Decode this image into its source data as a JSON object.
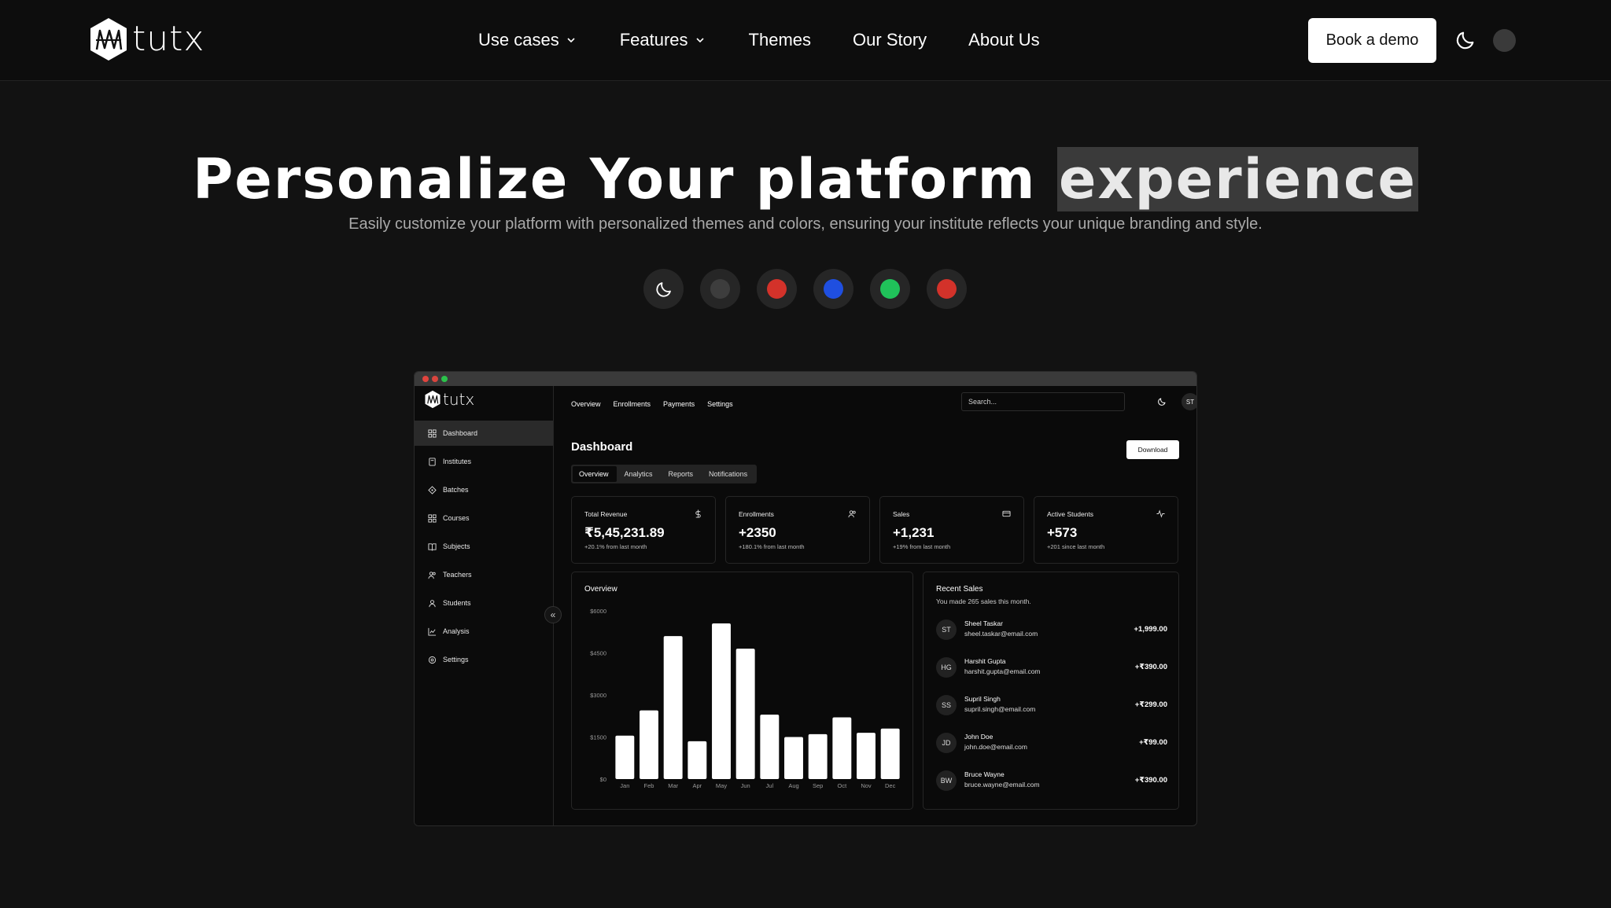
{
  "nav": {
    "brand": "tutx",
    "links": [
      {
        "label": "Use cases",
        "dropdown": true
      },
      {
        "label": "Features",
        "dropdown": true
      },
      {
        "label": "Themes",
        "dropdown": false
      },
      {
        "label": "Our Story",
        "dropdown": false
      },
      {
        "label": "About Us",
        "dropdown": false
      }
    ],
    "demo_label": "Book a demo"
  },
  "hero": {
    "title_main": "Personalize Your platform ",
    "title_highlight": "experience",
    "subtitle": "Easily customize your platform with personalized themes and colors, ensuring your institute reflects your unique branding and style."
  },
  "themes": [
    {
      "name": "dark-mode",
      "icon": "moon-icon"
    },
    {
      "name": "gray",
      "color": "#3d3d3d"
    },
    {
      "name": "red",
      "color": "#d3322a"
    },
    {
      "name": "blue",
      "color": "#1f4fe0"
    },
    {
      "name": "green",
      "color": "#20c25a"
    },
    {
      "name": "red-alt",
      "color": "#d3322a"
    }
  ],
  "app": {
    "brand": "tutx",
    "sidebar": [
      {
        "label": "Dashboard",
        "icon": "dashboard-icon",
        "active": true
      },
      {
        "label": "Institutes",
        "icon": "institute-icon"
      },
      {
        "label": "Batches",
        "icon": "batches-icon"
      },
      {
        "label": "Courses",
        "icon": "courses-icon"
      },
      {
        "label": "Subjects",
        "icon": "book-icon"
      },
      {
        "label": "Teachers",
        "icon": "users-icon"
      },
      {
        "label": "Students",
        "icon": "user-icon"
      },
      {
        "label": "Analysis",
        "icon": "analysis-icon"
      },
      {
        "label": "Settings",
        "icon": "gear-icon"
      }
    ],
    "collapse_glyph": "«",
    "topnav": [
      "Overview",
      "Enrollments",
      "Payments",
      "Settings"
    ],
    "search_placeholder": "Search...",
    "avatar": "ST",
    "page_title": "Dashboard",
    "download_label": "Download",
    "subtabs": [
      {
        "label": "Overview",
        "active": true
      },
      {
        "label": "Analytics"
      },
      {
        "label": "Reports"
      },
      {
        "label": "Notifications"
      }
    ],
    "cards": [
      {
        "label": "Total Revenue",
        "value": "₹5,45,231.89",
        "sub": "+20.1% from last month",
        "icon": "dollar-icon"
      },
      {
        "label": "Enrollments",
        "value": "+2350",
        "sub": "+180.1% from last month",
        "icon": "users-icon"
      },
      {
        "label": "Sales",
        "value": "+1,231",
        "sub": "+19% from last month",
        "icon": "credit-card-icon"
      },
      {
        "label": "Active Students",
        "value": "+573",
        "sub": "+201 since last month",
        "icon": "activity-icon"
      }
    ],
    "overview_title": "Overview",
    "recent": {
      "title": "Recent Sales",
      "desc": "You made 265 sales this month.",
      "rows": [
        {
          "initials": "ST",
          "name": "Sheel Taskar",
          "email": "sheel.taskar@email.com",
          "amount": "+1,999.00"
        },
        {
          "initials": "HG",
          "name": "Harshit Gupta",
          "email": "harshit.gupta@email.com",
          "amount": "+₹390.00"
        },
        {
          "initials": "SS",
          "name": "Supril Singh",
          "email": "supril.singh@email.com",
          "amount": "+₹299.00"
        },
        {
          "initials": "JD",
          "name": "John Doe",
          "email": "john.doe@email.com",
          "amount": "+₹99.00"
        },
        {
          "initials": "BW",
          "name": "Bruce Wayne",
          "email": "bruce.wayne@email.com",
          "amount": "+₹390.00"
        }
      ]
    }
  },
  "chart_data": {
    "type": "bar",
    "categories": [
      "Jan",
      "Feb",
      "Mar",
      "Apr",
      "May",
      "Jun",
      "Jul",
      "Aug",
      "Sep",
      "Oct",
      "Nov",
      "Dec"
    ],
    "values": [
      1550,
      2450,
      5100,
      1350,
      5550,
      4650,
      2300,
      1500,
      1600,
      2200,
      1650,
      1800
    ],
    "ytick_labels": [
      "$0",
      "$1500",
      "$3000",
      "$4500",
      "$6000"
    ],
    "ytick_values": [
      0,
      1500,
      3000,
      4500,
      6000
    ],
    "ylim": [
      0,
      6000
    ],
    "grid": false,
    "bar_color": "#ffffff"
  }
}
